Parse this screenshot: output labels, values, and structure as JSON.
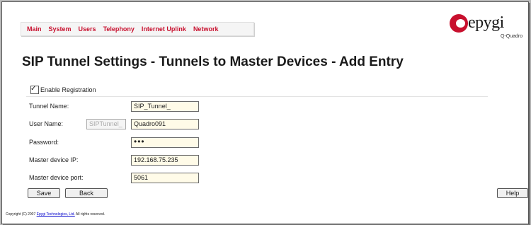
{
  "nav": {
    "items": [
      "Main",
      "System",
      "Users",
      "Telephony",
      "Internet Uplink",
      "Network"
    ]
  },
  "logo": {
    "brand": "epygi",
    "product": "Q-Quadro"
  },
  "page_title": "SIP Tunnel Settings - Tunnels to Master Devices - Add Entry",
  "form": {
    "enable_registration": {
      "label": "Enable Registration",
      "checked": true
    },
    "tunnel_name": {
      "label": "Tunnel Name:",
      "value": "SIP_Tunnel_"
    },
    "user_name": {
      "label": "User Name:",
      "prefix": "SIPTunnel_",
      "value": "Quadro091"
    },
    "password": {
      "label": "Password:",
      "value": "•••"
    },
    "master_ip": {
      "label": "Master device IP:",
      "value": "192.168.75.235"
    },
    "master_port": {
      "label": "Master device port:",
      "value": "5061"
    }
  },
  "buttons": {
    "save": "Save",
    "back": "Back",
    "help": "Help"
  },
  "footer": {
    "prefix": "Copyright (C) 2007",
    "link": "Epygi Technologies, Ltd.",
    "suffix": "All rights reserved."
  },
  "colors": {
    "nav_link": "#c8102e",
    "input_bg": "#fffbe8"
  }
}
